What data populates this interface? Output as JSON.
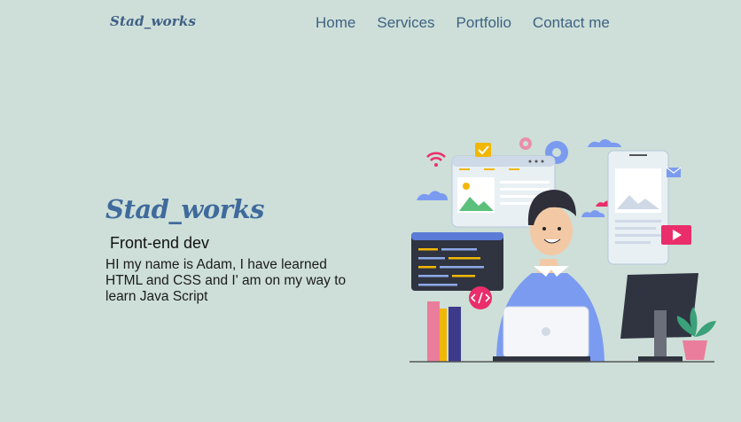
{
  "header": {
    "logo": "Stad_works",
    "nav": [
      {
        "label": "Home"
      },
      {
        "label": "Services"
      },
      {
        "label": "Portfolio"
      },
      {
        "label": "Contact me"
      }
    ]
  },
  "hero": {
    "brand": "Stad_works",
    "role": "Front-end dev",
    "bio": "HI my name is Adam, I have learned HTML and CSS and I' am on my way to learn Java Script"
  },
  "colors": {
    "background": "#cddfd8",
    "brand": "#3f6a9c",
    "nav": "#3f6282",
    "accent_pink": "#ea2e6b",
    "shirt": "#7b9bf1"
  },
  "illustration": {
    "icons": [
      "wifi-icon",
      "check-icon",
      "gear-icon",
      "cloud-icon",
      "mail-icon",
      "play-icon",
      "code-icon",
      "image-icon",
      "plant-icon",
      "laptop-icon",
      "monitor-icon",
      "books-icon"
    ]
  }
}
